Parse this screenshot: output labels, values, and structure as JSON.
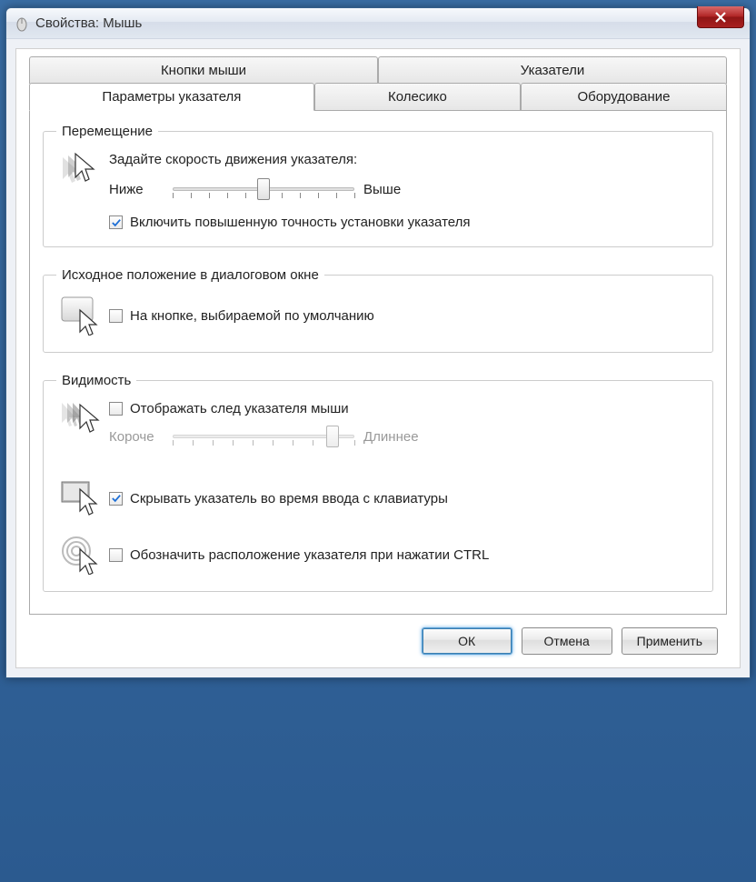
{
  "window": {
    "title": "Свойства: Мышь"
  },
  "tabs": {
    "row1": [
      {
        "label": "Кнопки мыши"
      },
      {
        "label": "Указатели"
      }
    ],
    "row2": [
      {
        "label": "Параметры указателя",
        "selected": true
      },
      {
        "label": "Колесико"
      },
      {
        "label": "Оборудование"
      }
    ]
  },
  "groups": {
    "motion": {
      "legend": "Перемещение",
      "speed_label": "Задайте скорость движения указателя:",
      "slow": "Ниже",
      "fast": "Выше",
      "enhance_checked": true,
      "enhance_label": "Включить повышенную точность установки указателя",
      "slider_value": 5,
      "slider_max": 10
    },
    "snap": {
      "legend": "Исходное положение в диалоговом окне",
      "checked": false,
      "label": "На кнопке, выбираемой по умолчанию"
    },
    "visibility": {
      "legend": "Видимость",
      "trails": {
        "checked": false,
        "label": "Отображать след указателя мыши",
        "short": "Короче",
        "long": "Длиннее",
        "slider_value": 9,
        "slider_max": 10
      },
      "hide": {
        "checked": true,
        "label": "Скрывать указатель во время ввода с клавиатуры"
      },
      "locate": {
        "checked": false,
        "label": "Обозначить расположение указателя при нажатии CTRL"
      }
    }
  },
  "buttons": {
    "ok": "ОК",
    "cancel": "Отмена",
    "apply": "Применить"
  }
}
